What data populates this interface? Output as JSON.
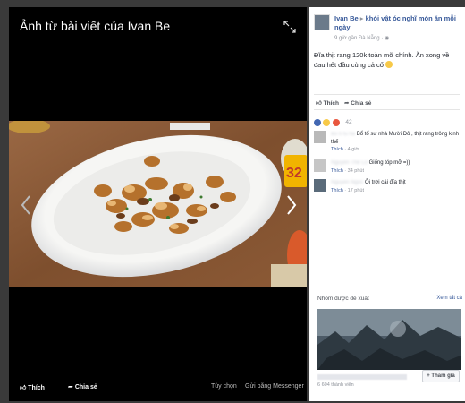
{
  "viewer": {
    "title": "Ảnh từ bài viết của Ivan Be",
    "bottom": {
      "like": "Thích",
      "share": "Chia sẻ",
      "options": "Tùy chọn",
      "send": "Gửi bằng Messenger"
    }
  },
  "panel": {
    "author": "Ivan Be",
    "arrow": "▸",
    "group": "khói vật óc nghĩ món ăn mỗi ngày",
    "meta": "9 giờ gần Đà Nẵng · ",
    "post_text": "Đĩa thịt rang 120k toàn mỡ chính. Ăn xong về đau hết đầu cùng cả cổ",
    "actions": {
      "like": "Thích",
      "share": "Chia sẻ"
    },
    "reactions_count": "42",
    "comments": [
      {
        "name": "Bo ti tu ha",
        "text": "Bổ tổ sư nhà Mười Đô , thịt rang trông kinh thế",
        "like": "Thích",
        "time": "4 giờ"
      },
      {
        "name": "Nguyen The Lo",
        "text": "Giống tóp mỡ =))",
        "like": "Thích",
        "time": "34 phút"
      },
      {
        "name": "Nguyen Ngoc",
        "text": "Ôi trời cái đĩa thịt",
        "like": "Thích",
        "time": "17 phút"
      }
    ],
    "suggest": {
      "title": "Nhóm được đề xuất",
      "see_all": "Xem tất cả",
      "members": "6 604 thành viên",
      "join": "+ Tham gia"
    }
  }
}
